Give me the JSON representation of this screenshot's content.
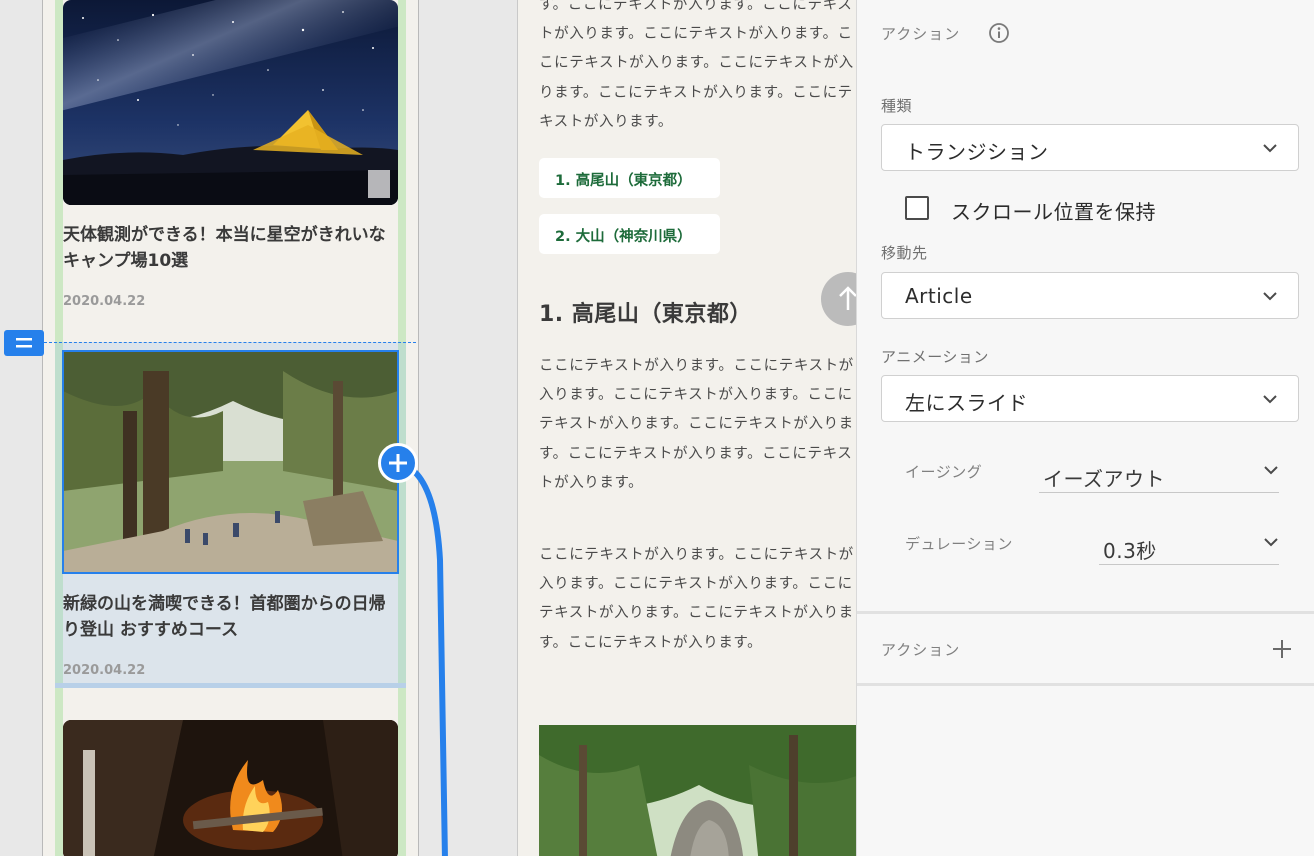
{
  "canvas": {
    "left_artboard": {
      "cards": [
        {
          "title": "天体観測ができる！本当に星空がきれいなキャンプ場10選",
          "date": "2020.04.22"
        },
        {
          "title": "新緑の山を満喫できる！首都圏からの日帰り登山 おすすめコース",
          "date": "2020.04.22"
        }
      ]
    },
    "right_artboard": {
      "intro_text": "す。ここにテキストが入ります。ここにテキストが入ります。ここにテキストが入ります。ここにテキストが入ります。ここにテキストが入ります。ここにテキストが入ります。ここにテキストが入ります。",
      "toc": [
        "1. 高尾山（東京都）",
        "2. 大山（神奈川県）"
      ],
      "heading": "1. 高尾山（東京都）",
      "para1": "ここにテキストが入ります。ここにテキストが入ります。ここにテキストが入ります。ここにテキストが入ります。ここにテキストが入ります。ここにテキストが入ります。ここにテキストが入ります。",
      "para2": "ここにテキストが入ります。ここにテキストが入ります。ここにテキストが入ります。ここにテキストが入ります。ここにテキストが入ります。ここにテキストが入ります。"
    }
  },
  "inspector": {
    "section_title": "アクション",
    "type_label": "種類",
    "type_value": "トランジション",
    "preserve_scroll_label": "スクロール位置を保持",
    "destination_label": "移動先",
    "destination_value": "Article",
    "animation_label": "アニメーション",
    "animation_value": "左にスライド",
    "easing_label": "イージング",
    "easing_value": "イーズアウト",
    "duration_label": "デュレーション",
    "duration_value": "0.3秒",
    "add_action_label": "アクション"
  },
  "colors": {
    "accent": "#2680eb",
    "toc_text": "#1d6b3a",
    "artboard_bg": "#f3f1ec",
    "panel_bg": "#f7f7f7"
  }
}
